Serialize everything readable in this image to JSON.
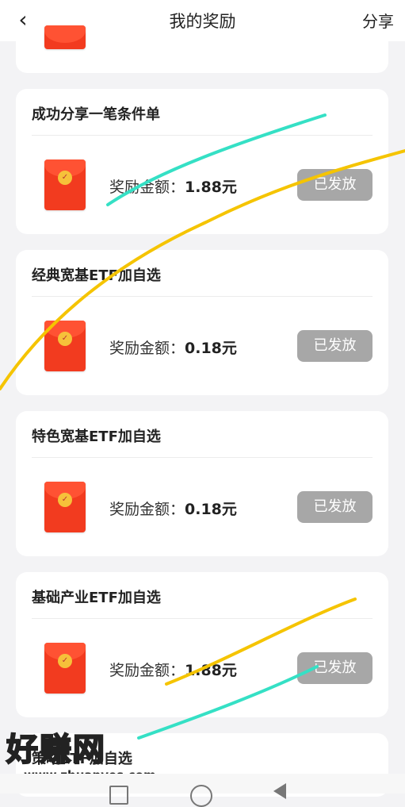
{
  "header": {
    "back_icon": "‹",
    "title": "我的奖励",
    "share_label": "分享"
  },
  "rewards": [
    {
      "title": "成功分享一笔条件单",
      "amount_label": "奖励金额：",
      "amount_value": "1.88元",
      "status": "已发放"
    },
    {
      "title": "经典宽基ETF加自选",
      "amount_label": "奖励金额：",
      "amount_value": "0.18元",
      "status": "已发放"
    },
    {
      "title": "特色宽基ETF加自选",
      "amount_label": "奖励金额：",
      "amount_value": "0.18元",
      "status": "已发放"
    },
    {
      "title": "基础产业ETF加自选",
      "amount_label": "奖励金额：",
      "amount_value": "1.88元",
      "status": "已发放"
    },
    {
      "title": "策略ETF加自选"
    }
  ],
  "watermark": {
    "brand": "好赚网",
    "url": "www.zhuanyes.com"
  },
  "colors": {
    "envelope": "#f23b1f",
    "status_button": "#a7a7a7",
    "scribble_yellow": "#f5c400",
    "scribble_cyan": "#35e0c5"
  }
}
